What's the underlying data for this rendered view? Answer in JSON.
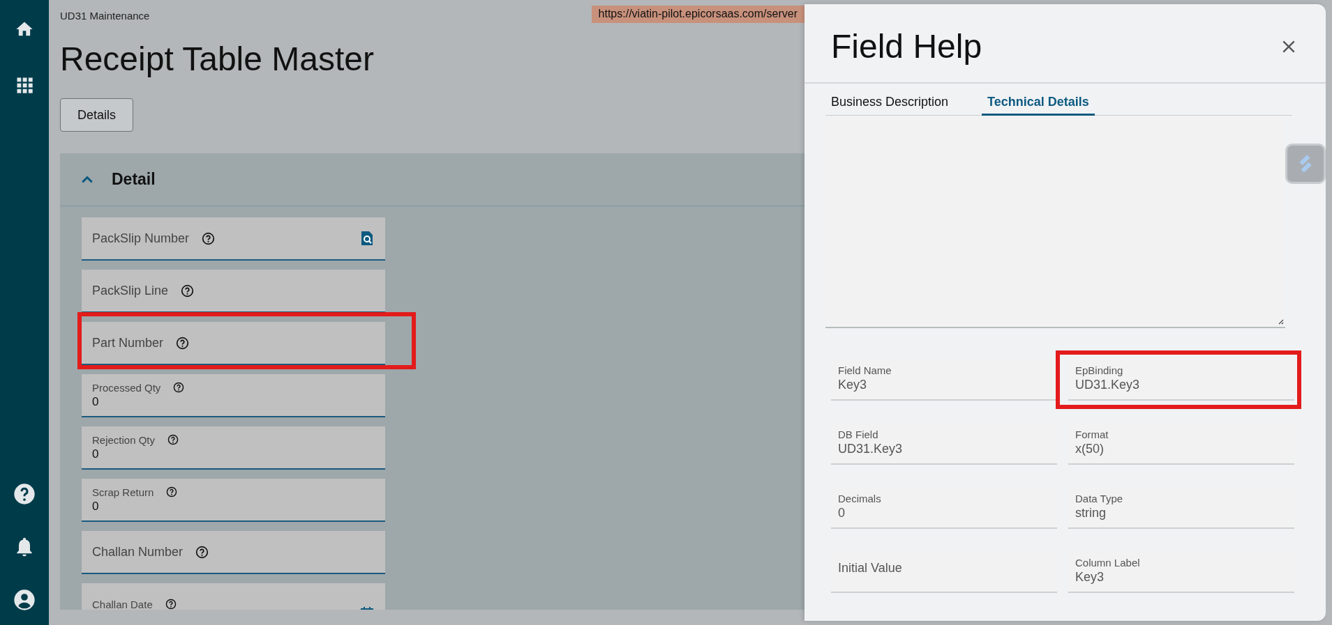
{
  "breadcrumb": "UD31 Maintenance",
  "url_tooltip": "https://viatin-pilot.epicorsaas.com/server",
  "title": "Receipt Table Master",
  "details_button": "Details",
  "section": {
    "title": "Detail",
    "expanded": true,
    "fields": [
      {
        "label": "PackSlip Number",
        "kind": "lookup",
        "highlighted": false
      },
      {
        "label": "PackSlip Line",
        "kind": "text",
        "highlighted": false
      },
      {
        "label": "Part Number",
        "kind": "text",
        "highlighted": true
      },
      {
        "label": "Processed Qty",
        "kind": "text",
        "value": "0",
        "highlighted": false
      },
      {
        "label": "Rejection Qty",
        "kind": "text",
        "value": "0",
        "highlighted": false
      },
      {
        "label": "Scrap Return",
        "kind": "text",
        "value": "0",
        "highlighted": false
      },
      {
        "label": "Challan Number",
        "kind": "text",
        "highlighted": false
      },
      {
        "label": "Challan Date",
        "kind": "date",
        "highlighted": false
      }
    ]
  },
  "field_help": {
    "title": "Field Help",
    "tabs": [
      {
        "label": "Business Description",
        "selected": false
      },
      {
        "label": "Technical Details",
        "selected": true
      }
    ],
    "fields": [
      {
        "label": "Field Name",
        "value": "Key3",
        "highlighted": false
      },
      {
        "label": "EpBinding",
        "value": "UD31.Key3",
        "highlighted": true
      },
      {
        "label": "DB Field",
        "value": "UD31.Key3",
        "highlighted": false
      },
      {
        "label": "Format",
        "value": "x(50)",
        "highlighted": false
      },
      {
        "label": "Decimals",
        "value": "0",
        "highlighted": false
      },
      {
        "label": "Data Type",
        "value": "string",
        "highlighted": false
      },
      {
        "label": "Initial Value",
        "highlighted": false
      },
      {
        "label": "Column Label",
        "value": "Key3",
        "highlighted": false
      }
    ]
  }
}
